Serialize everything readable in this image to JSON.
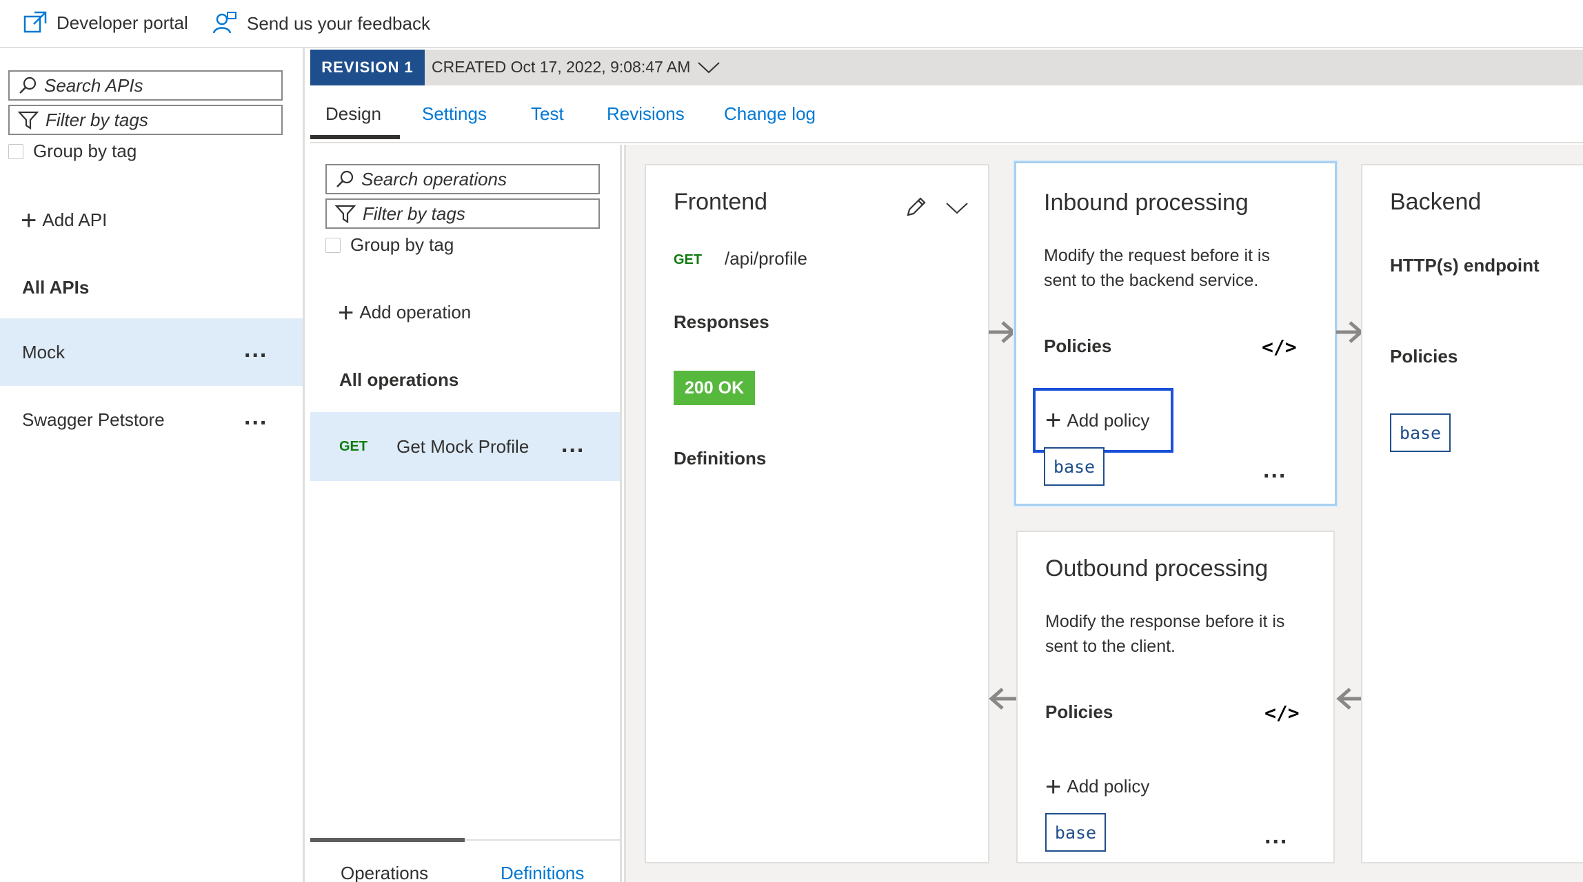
{
  "topbar": {
    "developer_portal": "Developer portal",
    "feedback": "Send us your feedback"
  },
  "sidebar": {
    "search_placeholder": "Search APIs",
    "filter_placeholder": "Filter by tags",
    "group_by_tag": "Group by tag",
    "add_api": "Add API",
    "all_apis": "All APIs",
    "apis": [
      {
        "name": "Mock",
        "selected": true
      },
      {
        "name": "Swagger Petstore",
        "selected": false
      }
    ]
  },
  "revision": {
    "badge": "REVISION 1",
    "created": "CREATED Oct 17, 2022, 9:08:47 AM"
  },
  "tabs": [
    "Design",
    "Settings",
    "Test",
    "Revisions",
    "Change log"
  ],
  "operations": {
    "search_placeholder": "Search operations",
    "filter_placeholder": "Filter by tags",
    "group_by_tag": "Group by tag",
    "add_operation": "Add operation",
    "all_operations": "All operations",
    "items": [
      {
        "method": "GET",
        "name": "Get Mock Profile",
        "selected": true
      }
    ],
    "bottom_tabs": [
      "Operations",
      "Definitions"
    ]
  },
  "frontend": {
    "title": "Frontend",
    "method": "GET",
    "path": "/api/profile",
    "responses_label": "Responses",
    "status": "200 OK",
    "definitions_label": "Definitions"
  },
  "inbound": {
    "title": "Inbound processing",
    "description_line1": "Modify the request before it is",
    "description_line2": "sent to the backend service.",
    "policies_label": "Policies",
    "add_policy": "Add policy",
    "base": "base"
  },
  "outbound": {
    "title": "Outbound processing",
    "description_line1": "Modify the response before it is",
    "description_line2": "sent to the client.",
    "policies_label": "Policies",
    "add_policy": "Add policy",
    "base": "base"
  },
  "backend": {
    "title": "Backend",
    "endpoint": "HTTP(s) endpoint",
    "policies_label": "Policies",
    "base": "base"
  },
  "colors": {
    "accent": "#0078d4",
    "revision_badge": "#1f4e8c",
    "selected_row": "#deecf9",
    "status_ok": "#57b83e",
    "focus_outline": "#1a4fd8"
  },
  "icons": {
    "code": "</>",
    "more": "..."
  }
}
